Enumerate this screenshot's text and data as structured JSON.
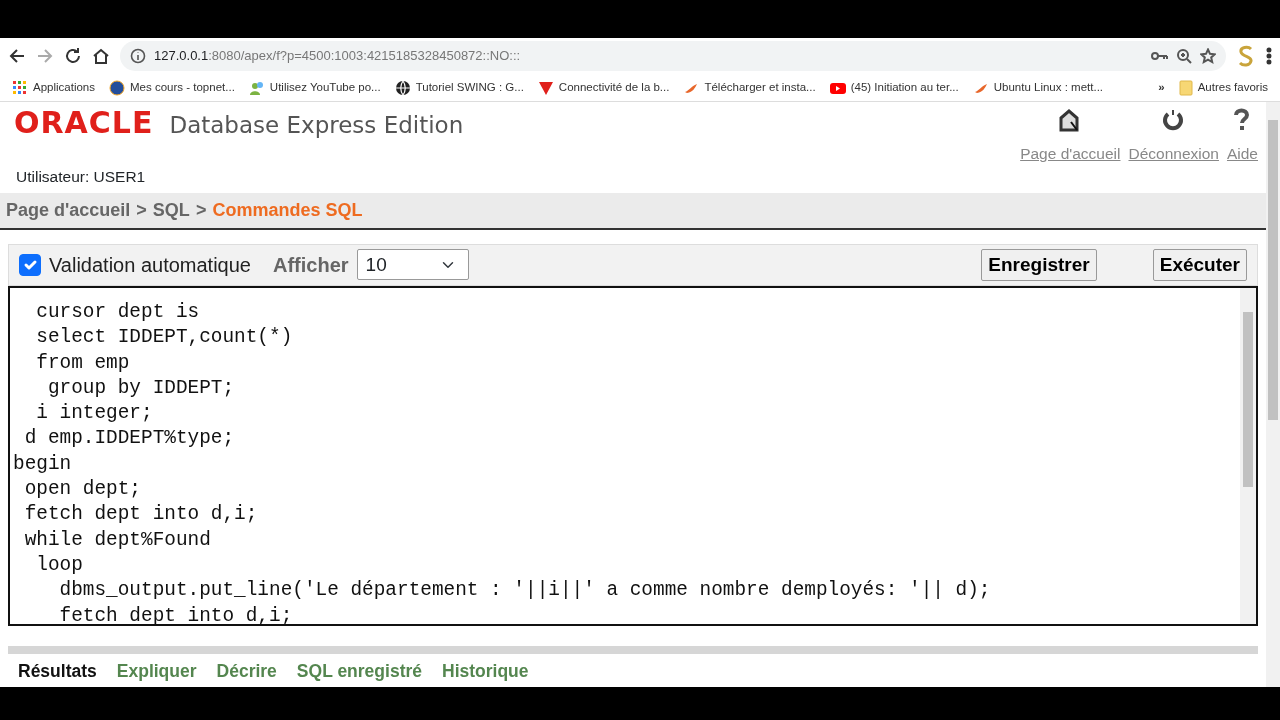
{
  "browser": {
    "url_host": "127.0.0.1",
    "url_rest": ":8080/apex/f?p=4500:1003:4215185328450872::NO:::",
    "bookmarks": [
      {
        "label": "Applications"
      },
      {
        "label": "Mes cours - topnet..."
      },
      {
        "label": "Utilisez YouTube po..."
      },
      {
        "label": "Tutoriel SWING : G..."
      },
      {
        "label": "Connectivité de la b..."
      },
      {
        "label": "Télécharger et insta..."
      },
      {
        "label": "(45) Initiation au ter..."
      },
      {
        "label": "Ubuntu Linux : mett..."
      }
    ],
    "more": "»",
    "other_bookmarks": "Autres favoris"
  },
  "header": {
    "logo": "ORACLE",
    "product": "Database Express Edition",
    "user": "Utilisateur: USER1",
    "links": [
      {
        "label": "Page d'accueil"
      },
      {
        "label": "Déconnexion"
      },
      {
        "label": "Aide"
      }
    ]
  },
  "breadcrumb": [
    {
      "label": "Page d'accueil",
      "current": false
    },
    {
      "label": "SQL",
      "current": false
    },
    {
      "label": "Commandes SQL",
      "current": true
    }
  ],
  "breadcrumb_separator": ">",
  "toolbar": {
    "autocommit": {
      "label": "Validation automatique",
      "checked": true
    },
    "show_label": "Afficher",
    "show_value": "10",
    "buttons": [
      "Enregistrer",
      "Exécuter"
    ]
  },
  "editor": {
    "lines": [
      "  cursor dept is",
      "  select IDDEPT,count(*)",
      "  from emp",
      "   group by IDDEPT;",
      "  i integer;",
      " d emp.IDDEPT%type;",
      "begin",
      " open dept;",
      " fetch dept into d,i;",
      " while dept%Found",
      "  loop",
      "    dbms_output.put_line('Le département : '||i||' a comme nombre demployés: '|| d);",
      "    fetch dept into d,i;"
    ]
  },
  "tabs": [
    {
      "label": "Résultats",
      "selected": true
    },
    {
      "label": "Expliquer",
      "selected": false
    },
    {
      "label": "Décrire",
      "selected": false
    },
    {
      "label": "SQL enregistré",
      "selected": false
    },
    {
      "label": "Historique",
      "selected": false
    }
  ]
}
